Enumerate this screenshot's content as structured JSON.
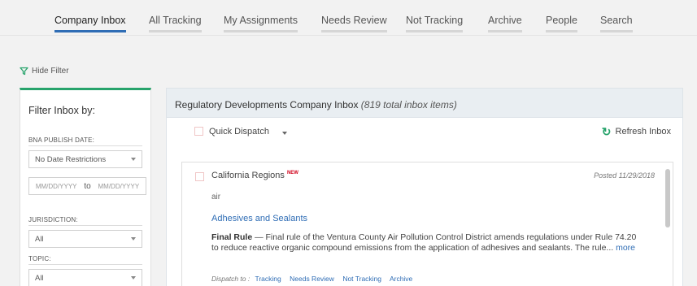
{
  "nav": {
    "tabs": [
      {
        "label": "Company Inbox",
        "active": true
      },
      {
        "label": "All Tracking"
      },
      {
        "label": "My Assignments"
      },
      {
        "label": "Needs Review"
      },
      {
        "label": "Not Tracking"
      },
      {
        "label": "Archive"
      },
      {
        "label": "People"
      },
      {
        "label": "Search"
      }
    ],
    "accent": "#2f6db5"
  },
  "filter_toggle": {
    "label": "Hide Filter",
    "icon": "filter-icon"
  },
  "filter": {
    "title": "Filter Inbox by:",
    "date_label": "BNA PUBLISH DATE:",
    "date_select": "No Date Restrictions",
    "date_from_placeholder": "MM/DD/YYYY",
    "date_to_word": "to",
    "date_to_placeholder": "MM/DD/YYYY",
    "jurisdiction_label": "JURISDICTION:",
    "jurisdiction_value": "All",
    "topic_label": "TOPIC:",
    "topic_value": "All",
    "accent": "#27a36b"
  },
  "inbox": {
    "title": "Regulatory Developments Company Inbox",
    "count": "(819 total inbox items)",
    "quick_dispatch": "Quick Dispatch",
    "refresh": "Refresh Inbox",
    "refresh_icon": "refresh-icon"
  },
  "item": {
    "source": "California Regions",
    "badge": "NEW",
    "posted": "Posted 11/29/2018",
    "keyword": "air",
    "topic_link": "Adhesives and Sealants",
    "type": "Final Rule",
    "summary": " — Final rule of the Ventura County Air Pollution Control District amends regulations under Rule 74.20 to reduce reactive organic compound emissions from the application of adhesives and sealants. The rule...",
    "more": "more",
    "dispatch_label": "Dispatch to :",
    "dispatch_actions": [
      "Tracking",
      "Needs Review",
      "Not Tracking",
      "Archive"
    ]
  }
}
